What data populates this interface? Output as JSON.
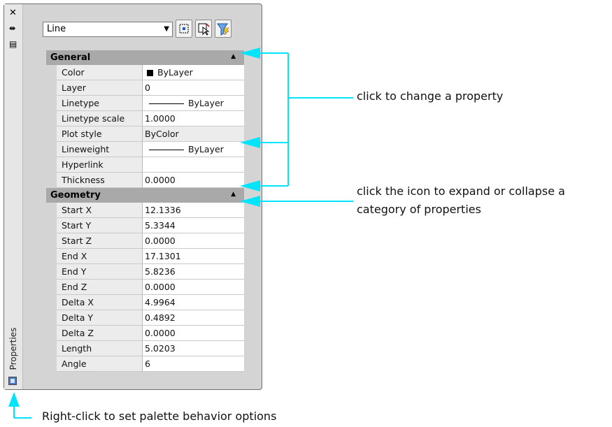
{
  "palette": {
    "title": "Properties",
    "object_type": "Line",
    "sections": [
      {
        "name": "General",
        "rows": [
          {
            "label": "Color",
            "value": "ByLayer",
            "kind": "swatch"
          },
          {
            "label": "Layer",
            "value": "0",
            "kind": "text"
          },
          {
            "label": "Linetype",
            "value": "ByLayer",
            "kind": "line"
          },
          {
            "label": "Linetype scale",
            "value": "1.0000",
            "kind": "text"
          },
          {
            "label": "Plot style",
            "value": "ByColor",
            "kind": "text"
          },
          {
            "label": "Lineweight",
            "value": "ByLayer",
            "kind": "line"
          },
          {
            "label": "Hyperlink",
            "value": "",
            "kind": "text"
          },
          {
            "label": "Thickness",
            "value": "0.0000",
            "kind": "text"
          }
        ]
      },
      {
        "name": "Geometry",
        "rows": [
          {
            "label": "Start X",
            "value": "12.1336"
          },
          {
            "label": "Start Y",
            "value": "5.3344"
          },
          {
            "label": "Start Z",
            "value": "0.0000"
          },
          {
            "label": "End X",
            "value": "17.1301"
          },
          {
            "label": "End Y",
            "value": "5.8236"
          },
          {
            "label": "End Z",
            "value": "0.0000"
          },
          {
            "label": "Delta X",
            "value": "4.9964"
          },
          {
            "label": "Delta Y",
            "value": "0.4892"
          },
          {
            "label": "Delta Z",
            "value": "0.0000"
          },
          {
            "label": "Length",
            "value": "5.0203"
          },
          {
            "label": "Angle",
            "value": "6"
          }
        ]
      }
    ]
  },
  "callouts": {
    "change_property": "click to change a property",
    "expand_collapse_line1": "click the icon to expand or collapse a",
    "expand_collapse_line2": "category of properties",
    "right_click": "Right-click to set palette behavior options"
  },
  "colors": {
    "arrow": "#00e5ff",
    "category_bg": "#a9a9a9"
  }
}
